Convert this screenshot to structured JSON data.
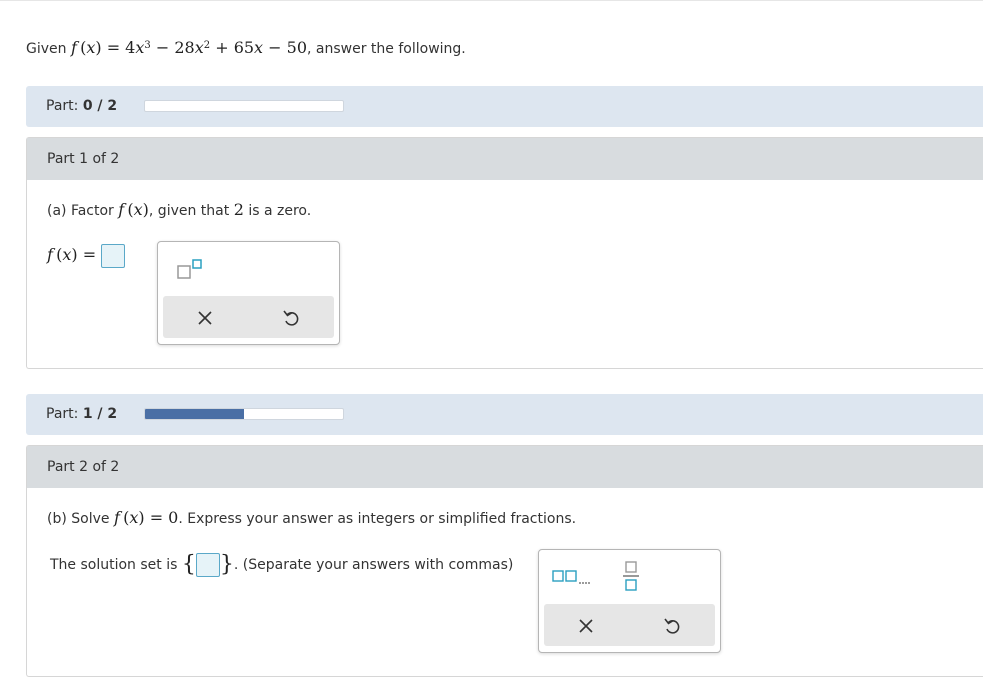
{
  "problem": {
    "prefix": "Given",
    "suffix": ", answer the following."
  },
  "part_a_status": {
    "label": "Part:",
    "value": "0 / 2",
    "progress": 0
  },
  "part1": {
    "header": "Part 1 of 2",
    "question_prefix": "(a) Factor",
    "question_mid": ", given that",
    "question_num": "2",
    "question_suffix": "is a zero."
  },
  "part_b_status": {
    "label": "Part:",
    "value": "1 / 2",
    "progress": 0.5
  },
  "part2": {
    "header": "Part 2 of 2",
    "question_prefix": "(b) Solve",
    "question_suffix": ". Express your answer as integers or simplified fractions.",
    "solution_label": "The solution set is",
    "solution_hint": ". (Separate your answers with commas)"
  },
  "colors": {
    "accent": "#4a6fa5",
    "bar_bg": "#dde6f0",
    "header_bg": "#d8dcdf",
    "input_border": "#5aa8c8"
  },
  "icons": [
    "superscript-tool-icon",
    "clear-icon",
    "undo-icon",
    "list-tool-icon",
    "fraction-tool-icon"
  ]
}
